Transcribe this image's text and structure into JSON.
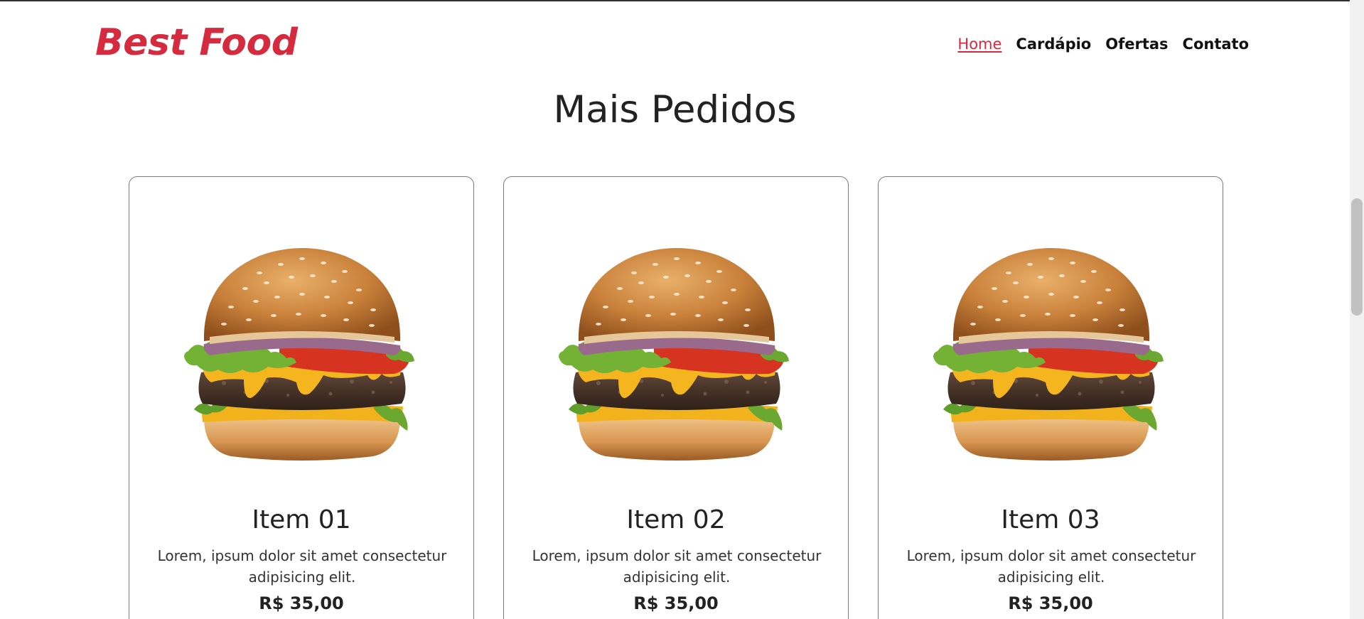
{
  "app": {
    "brand": "Best Food",
    "brand_color": "#d62a3e",
    "accent_color": "#d62a3e"
  },
  "nav": {
    "items": [
      {
        "label": "Home",
        "active": true
      },
      {
        "label": "Cardápio",
        "active": false
      },
      {
        "label": "Ofertas",
        "active": false
      },
      {
        "label": "Contato",
        "active": false
      }
    ]
  },
  "section": {
    "title": "Mais Pedidos"
  },
  "cards": [
    {
      "title": "Item 01",
      "description": "Lorem, ipsum dolor sit amet consectetur adipisicing elit.",
      "price": "R$ 35,00",
      "image_icon": "burger-image"
    },
    {
      "title": "Item 02",
      "description": "Lorem, ipsum dolor sit amet consectetur adipisicing elit.",
      "price": "R$ 35,00",
      "image_icon": "burger-image"
    },
    {
      "title": "Item 03",
      "description": "Lorem, ipsum dolor sit amet consectetur adipisicing elit.",
      "price": "R$ 35,00",
      "image_icon": "burger-image"
    }
  ],
  "scrollbar": {
    "position_fraction": 0.32,
    "visible_fraction": 0.19
  }
}
